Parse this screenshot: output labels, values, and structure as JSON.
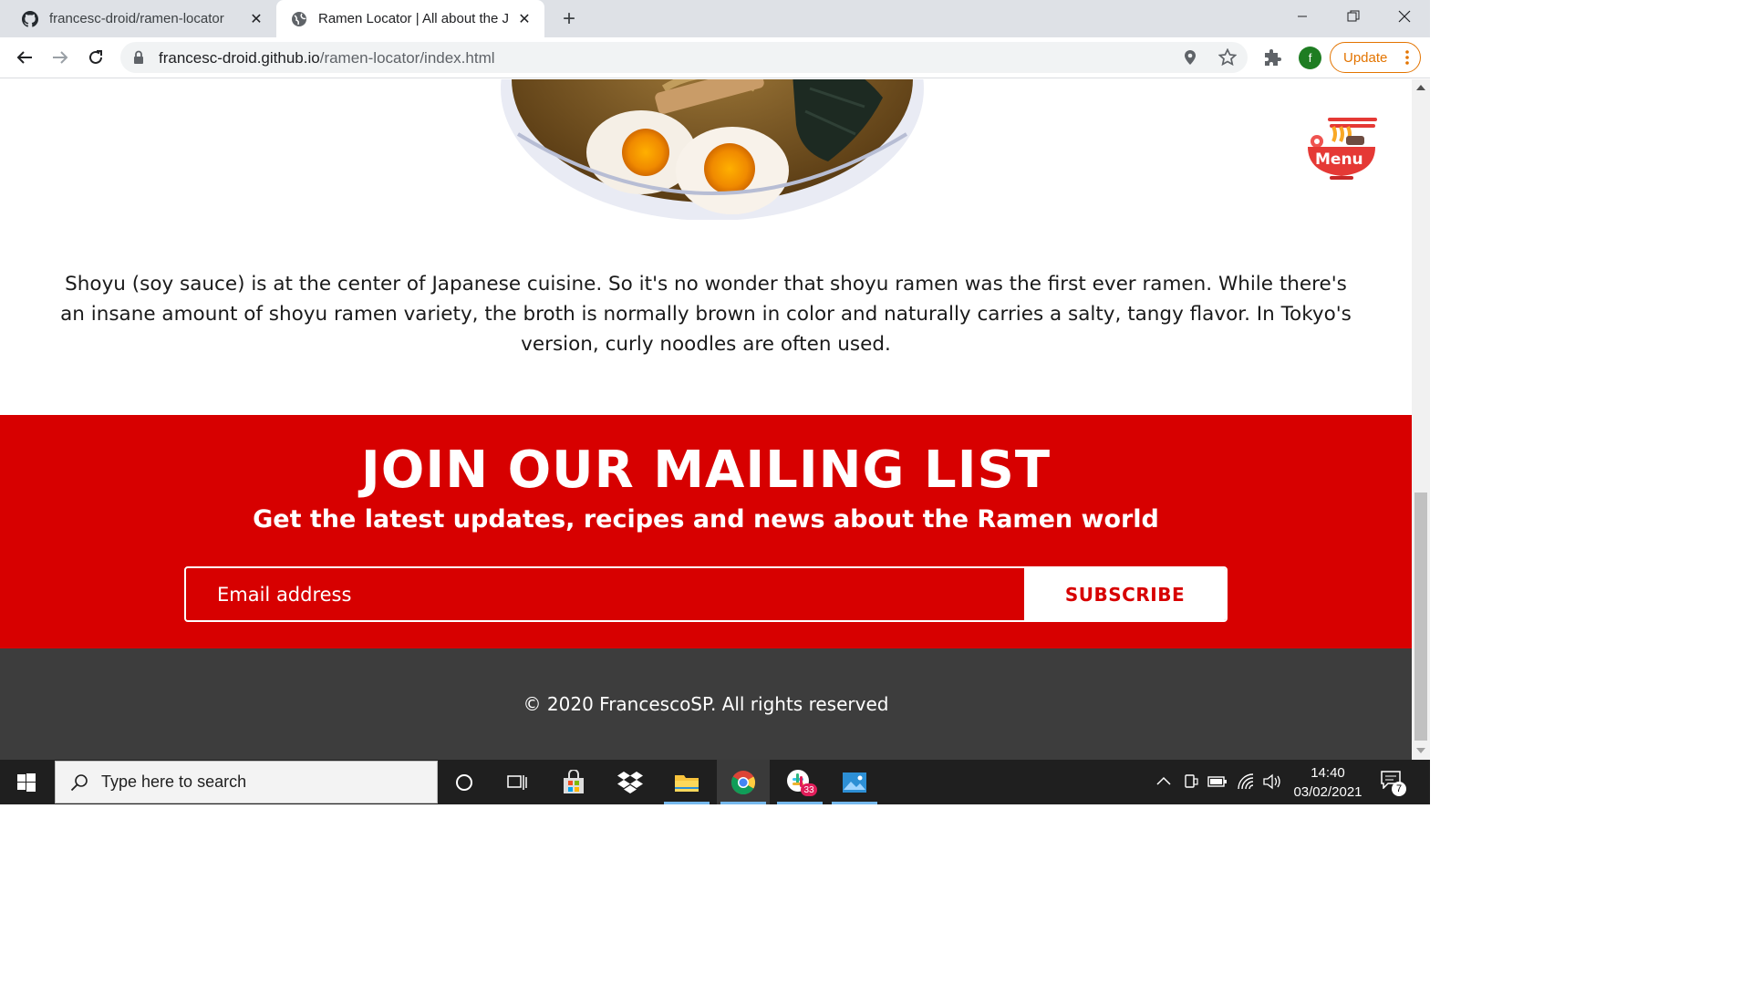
{
  "browser": {
    "tabs": [
      {
        "title": "francesc-droid/ramen-locator",
        "icon": "github-icon"
      },
      {
        "title": "Ramen Locator | All about the Japanese Ramen",
        "icon": "globe-icon"
      }
    ],
    "url_host": "francesc-droid.github.io",
    "url_path": "/ramen-locator/index.html",
    "profile_initial": "f",
    "update_label": "Update"
  },
  "page": {
    "menu_label": "Menu",
    "description": "Shoyu (soy sauce) is at the center of Japanese cuisine. So it's no wonder that shoyu ramen was the first ever ramen. While there's an insane amount of shoyu ramen variety, the broth is normally brown in color and naturally carries a salty, tangy flavor. In Tokyo's version, curly noodles are often used.",
    "mailing": {
      "heading": "JOIN OUR MAILING LIST",
      "subheading": "Get the latest updates, recipes and news about the Ramen world",
      "email_placeholder": "Email address",
      "subscribe_label": "SUBSCRIBE"
    },
    "footer": {
      "copyright": "© 2020 FrancescoSP. All rights reserved"
    }
  },
  "taskbar": {
    "search_placeholder": "Type here to search",
    "time": "14:40",
    "date": "03/02/2021",
    "slack_badge": "33",
    "notification_count": "7"
  },
  "colors": {
    "brand_red": "#d70000",
    "footer_gray": "#3d3d3d",
    "update_orange": "#e37400"
  }
}
